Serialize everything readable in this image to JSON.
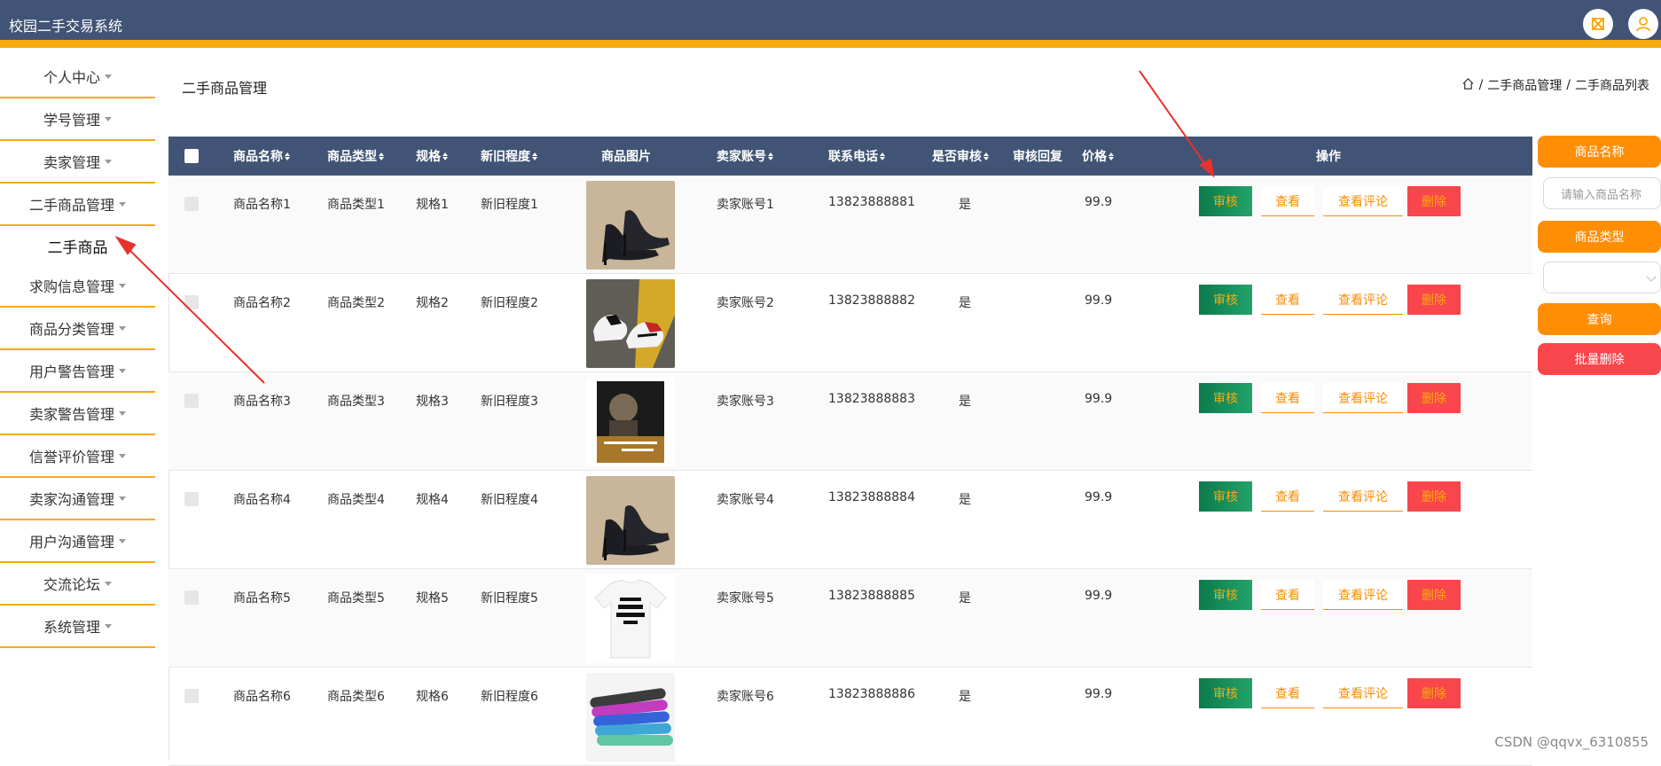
{
  "app": {
    "title": "校园二手交易系统"
  },
  "topbar": {
    "icons": [
      "fullscreen-icon",
      "user-icon"
    ]
  },
  "sidebar": {
    "items": [
      {
        "label": "个人中心",
        "caret": true
      },
      {
        "label": "学号管理",
        "caret": true
      },
      {
        "label": "卖家管理",
        "caret": true
      },
      {
        "label": "二手商品管理",
        "caret": true
      },
      {
        "label": "二手商品",
        "caret": false,
        "sub": true
      },
      {
        "label": "求购信息管理",
        "caret": true
      },
      {
        "label": "商品分类管理",
        "caret": true
      },
      {
        "label": "用户警告管理",
        "caret": true
      },
      {
        "label": "卖家警告管理",
        "caret": true
      },
      {
        "label": "信誉评价管理",
        "caret": true
      },
      {
        "label": "卖家沟通管理",
        "caret": true
      },
      {
        "label": "用户沟通管理",
        "caret": true
      },
      {
        "label": "交流论坛",
        "caret": true
      },
      {
        "label": "系统管理",
        "caret": true
      }
    ]
  },
  "page": {
    "title": "二手商品管理"
  },
  "breadcrumb": {
    "items": [
      "二手商品管理",
      "二手商品列表"
    ],
    "separator": "/"
  },
  "table": {
    "headers": {
      "name": "商品名称",
      "type": "商品类型",
      "spec": "规格",
      "condition": "新旧程度",
      "image": "商品图片",
      "seller": "卖家账号",
      "phone": "联系电话",
      "audited": "是否审核",
      "reply": "审核回复",
      "price": "价格",
      "actions": "操作"
    },
    "sortable": [
      "name",
      "type",
      "spec",
      "condition",
      "seller",
      "phone",
      "audited",
      "price"
    ],
    "action_labels": {
      "audit": "审核",
      "view": "查看",
      "comments": "查看评论",
      "delete": "删除"
    },
    "rows": [
      {
        "name": "商品名称1",
        "type": "商品类型1",
        "spec": "规格1",
        "condition": "新旧程度1",
        "image": "high-heel-shoe",
        "seller": "卖家账号1",
        "phone": "13823888881",
        "audited": "是",
        "reply": "",
        "price": "99.9"
      },
      {
        "name": "商品名称2",
        "type": "商品类型2",
        "spec": "规格2",
        "condition": "新旧程度2",
        "image": "sneakers",
        "seller": "卖家账号2",
        "phone": "13823888882",
        "audited": "是",
        "reply": "",
        "price": "99.9"
      },
      {
        "name": "商品名称3",
        "type": "商品类型3",
        "spec": "规格3",
        "condition": "新旧程度3",
        "image": "book",
        "seller": "卖家账号3",
        "phone": "13823888883",
        "audited": "是",
        "reply": "",
        "price": "99.9"
      },
      {
        "name": "商品名称4",
        "type": "商品类型4",
        "spec": "规格4",
        "condition": "新旧程度4",
        "image": "high-heel-shoe",
        "seller": "卖家账号4",
        "phone": "13823888884",
        "audited": "是",
        "reply": "",
        "price": "99.9"
      },
      {
        "name": "商品名称5",
        "type": "商品类型5",
        "spec": "规格5",
        "condition": "新旧程度5",
        "image": "t-shirt",
        "seller": "卖家账号5",
        "phone": "13823888885",
        "audited": "是",
        "reply": "",
        "price": "99.9"
      },
      {
        "name": "商品名称6",
        "type": "商品类型6",
        "spec": "规格6",
        "condition": "新旧程度6",
        "image": "resistance-bands",
        "seller": "卖家账号6",
        "phone": "13823888886",
        "audited": "是",
        "reply": "",
        "price": "99.9"
      }
    ]
  },
  "filters": {
    "name_label": "商品名称",
    "name_placeholder": "请输入商品名称",
    "type_label": "商品类型",
    "type_value": "",
    "search_button": "查询",
    "batch_delete_button": "批量删除"
  },
  "colors": {
    "header_bg": "#415475",
    "accent": "#f8ab0e",
    "orange": "#ff8e04",
    "audit_green": "#0c7a4c",
    "delete_red": "#f9464c",
    "annotation_arrow": "#e8322d"
  },
  "annotations": {
    "arrows": 2
  },
  "watermark": "CSDN @qqvx_6310855"
}
